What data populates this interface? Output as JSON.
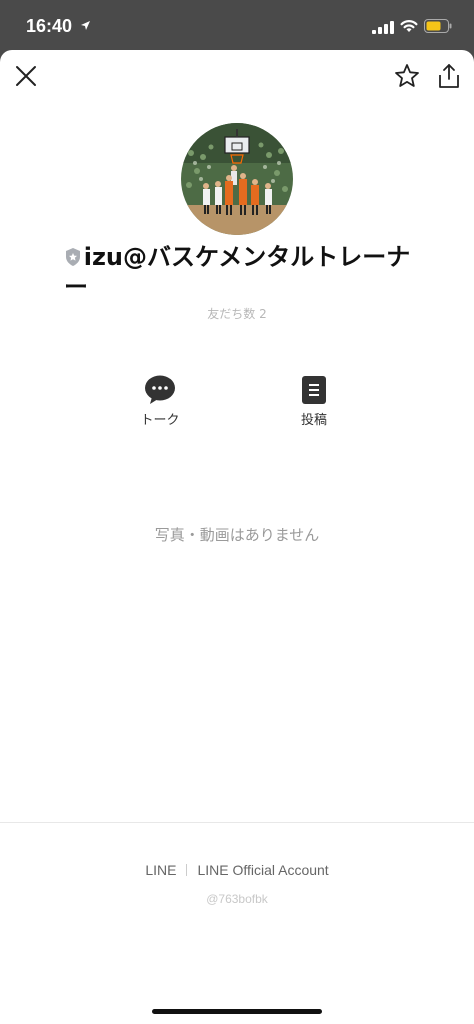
{
  "status_bar": {
    "time": "16:40"
  },
  "profile": {
    "name_line1": "izu@バスケメンタルトレーナ",
    "name_line2": "ー",
    "friends_count": "友だち数 2"
  },
  "actions": {
    "talk_label": "トーク",
    "post_label": "投稿"
  },
  "empty_message": "写真・動画はありません",
  "footer": {
    "link_line": "LINE",
    "link_official": "LINE Official Account",
    "account_id": "@763bofbk"
  },
  "colors": {
    "sheet_bg": "#ffffff",
    "backdrop": "#4a4a4a",
    "battery": "#f5c518",
    "muted_text": "#9a9a9a"
  }
}
